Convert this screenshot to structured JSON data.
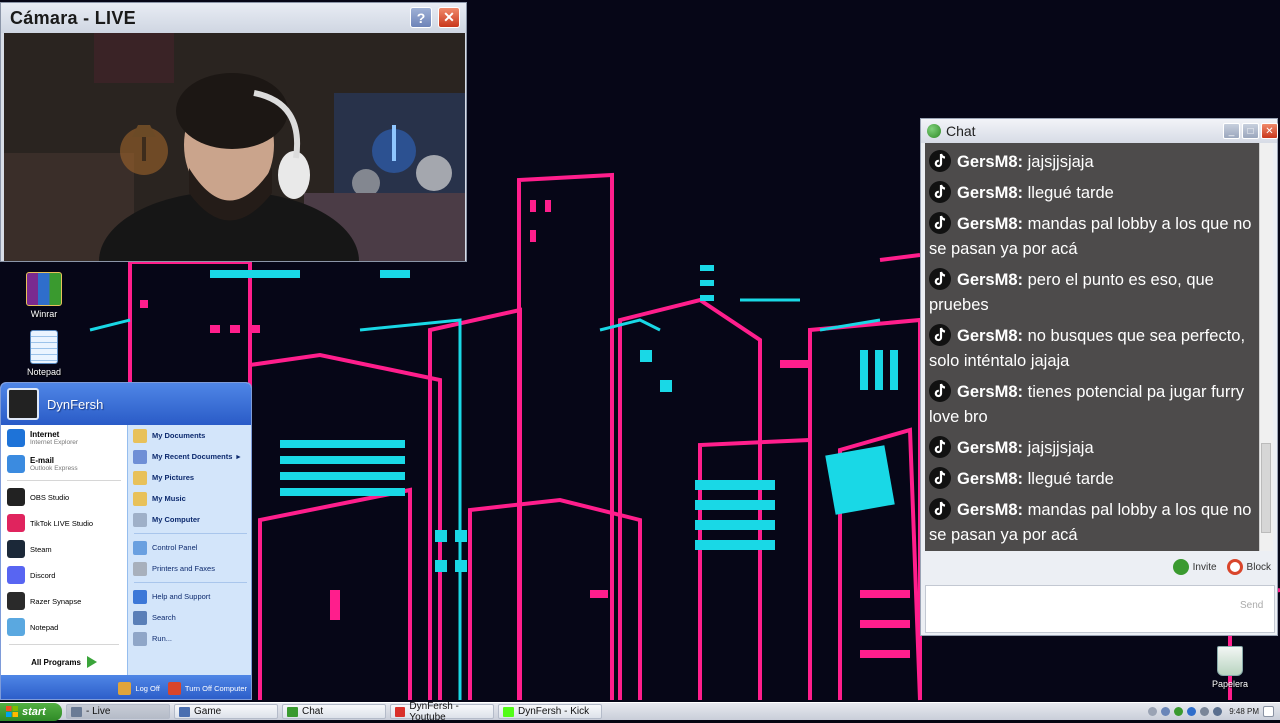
{
  "camera_window": {
    "title": "Cámara - LIVE",
    "help_label": "?",
    "close_label": "✕"
  },
  "desktop_icons": [
    {
      "label": "Winrar",
      "icon": "winrar-icon"
    },
    {
      "label": "Notepad",
      "icon": "notepad-icon"
    },
    {
      "label": "Papelera",
      "icon": "recycle-bin-icon"
    }
  ],
  "start_menu": {
    "user_name": "DynFersh",
    "left_items": [
      {
        "title": "Internet",
        "subtitle": "Internet Explorer",
        "icon": "internet-explorer-icon",
        "color": "#1e73d8"
      },
      {
        "title": "E-mail",
        "subtitle": "Outlook Express",
        "icon": "outlook-icon",
        "color": "#3b8be0"
      },
      {
        "title": "OBS Studio",
        "subtitle": "",
        "icon": "obs-icon",
        "color": "#222222"
      },
      {
        "title": "TikTok LIVE Studio",
        "subtitle": "",
        "icon": "tiktok-icon",
        "color": "#e0245e"
      },
      {
        "title": "Steam",
        "subtitle": "",
        "icon": "steam-icon",
        "color": "#1b2838"
      },
      {
        "title": "Discord",
        "subtitle": "",
        "icon": "discord-icon",
        "color": "#5865f2"
      },
      {
        "title": "Razer Synapse",
        "subtitle": "",
        "icon": "razer-icon",
        "color": "#2a2a2a"
      },
      {
        "title": "Notepad",
        "subtitle": "",
        "icon": "notepad-icon",
        "color": "#5aa8e0"
      }
    ],
    "all_programs": "All Programs",
    "right_items": [
      {
        "label": "My Documents",
        "bold": true,
        "icon": "documents-icon",
        "color": "#e8c15a"
      },
      {
        "label": "My Recent Documents",
        "bold": true,
        "icon": "recent-documents-icon",
        "color": "#6f8fd6",
        "arrow": "▸"
      },
      {
        "label": "My Pictures",
        "bold": true,
        "icon": "pictures-icon",
        "color": "#e8c15a"
      },
      {
        "label": "My Music",
        "bold": true,
        "icon": "music-icon",
        "color": "#e8c15a"
      },
      {
        "label": "My Computer",
        "bold": true,
        "icon": "computer-icon",
        "color": "#9fb0c8"
      },
      {
        "label": "Control Panel",
        "bold": false,
        "icon": "control-panel-icon",
        "color": "#6aa0e0"
      },
      {
        "label": "Printers and Faxes",
        "bold": false,
        "icon": "printer-icon",
        "color": "#a8b0bc"
      },
      {
        "label": "Help and Support",
        "bold": false,
        "icon": "help-icon",
        "color": "#3c78d8"
      },
      {
        "label": "Search",
        "bold": false,
        "icon": "search-icon",
        "color": "#5a7fb8"
      },
      {
        "label": "Run...",
        "bold": false,
        "icon": "run-icon",
        "color": "#8fa6c8"
      }
    ],
    "log_off": "Log Off",
    "turn_off": "Turn Off Computer"
  },
  "chat": {
    "title": "Chat",
    "messages": [
      {
        "user": "GersM8:",
        "text": "tienes potencial pa jugar furry love bro"
      },
      {
        "user": "GersM8:",
        "text": "jajsjjsjaja"
      },
      {
        "user": "GersM8:",
        "text": "llegué tarde"
      },
      {
        "user": "GersM8:",
        "text": "mandas pal lobby a los que no se pasan ya por acá"
      },
      {
        "user": "GersM8:",
        "text": "pero el punto es eso, que pruebes"
      },
      {
        "user": "GersM8:",
        "text": "no busques que sea perfecto, solo inténtalo jajaja"
      },
      {
        "user": "GersM8:",
        "text": "tienes potencial pa jugar furry love bro"
      },
      {
        "user": "GersM8:",
        "text": "jajsjjsjaja"
      },
      {
        "user": "GersM8:",
        "text": "llegué tarde"
      },
      {
        "user": "GersM8:",
        "text": "mandas pal lobby a los que no se pasan ya por acá"
      }
    ],
    "invite_label": "Invite",
    "block_label": "Block",
    "input_value": "",
    "send_label": "Send"
  },
  "taskbar": {
    "start_label": "start",
    "tasks": [
      {
        "label": "- Live",
        "icon": "window-icon",
        "active": true
      },
      {
        "label": "Game",
        "icon": "game-icon",
        "active": false
      },
      {
        "label": "Chat",
        "icon": "chat-icon",
        "active": false
      },
      {
        "label": "DynFersh - Youtube",
        "icon": "youtube-icon",
        "active": false
      },
      {
        "label": "DynFersh - Kick",
        "icon": "kick-icon",
        "active": false
      }
    ],
    "clock": "9:48 PM"
  },
  "colors": {
    "neon_pink": "#ff1e8c",
    "neon_cyan": "#19d8e6",
    "xp_blue": "#2a5bc7",
    "xp_green": "#3a9a2f"
  }
}
